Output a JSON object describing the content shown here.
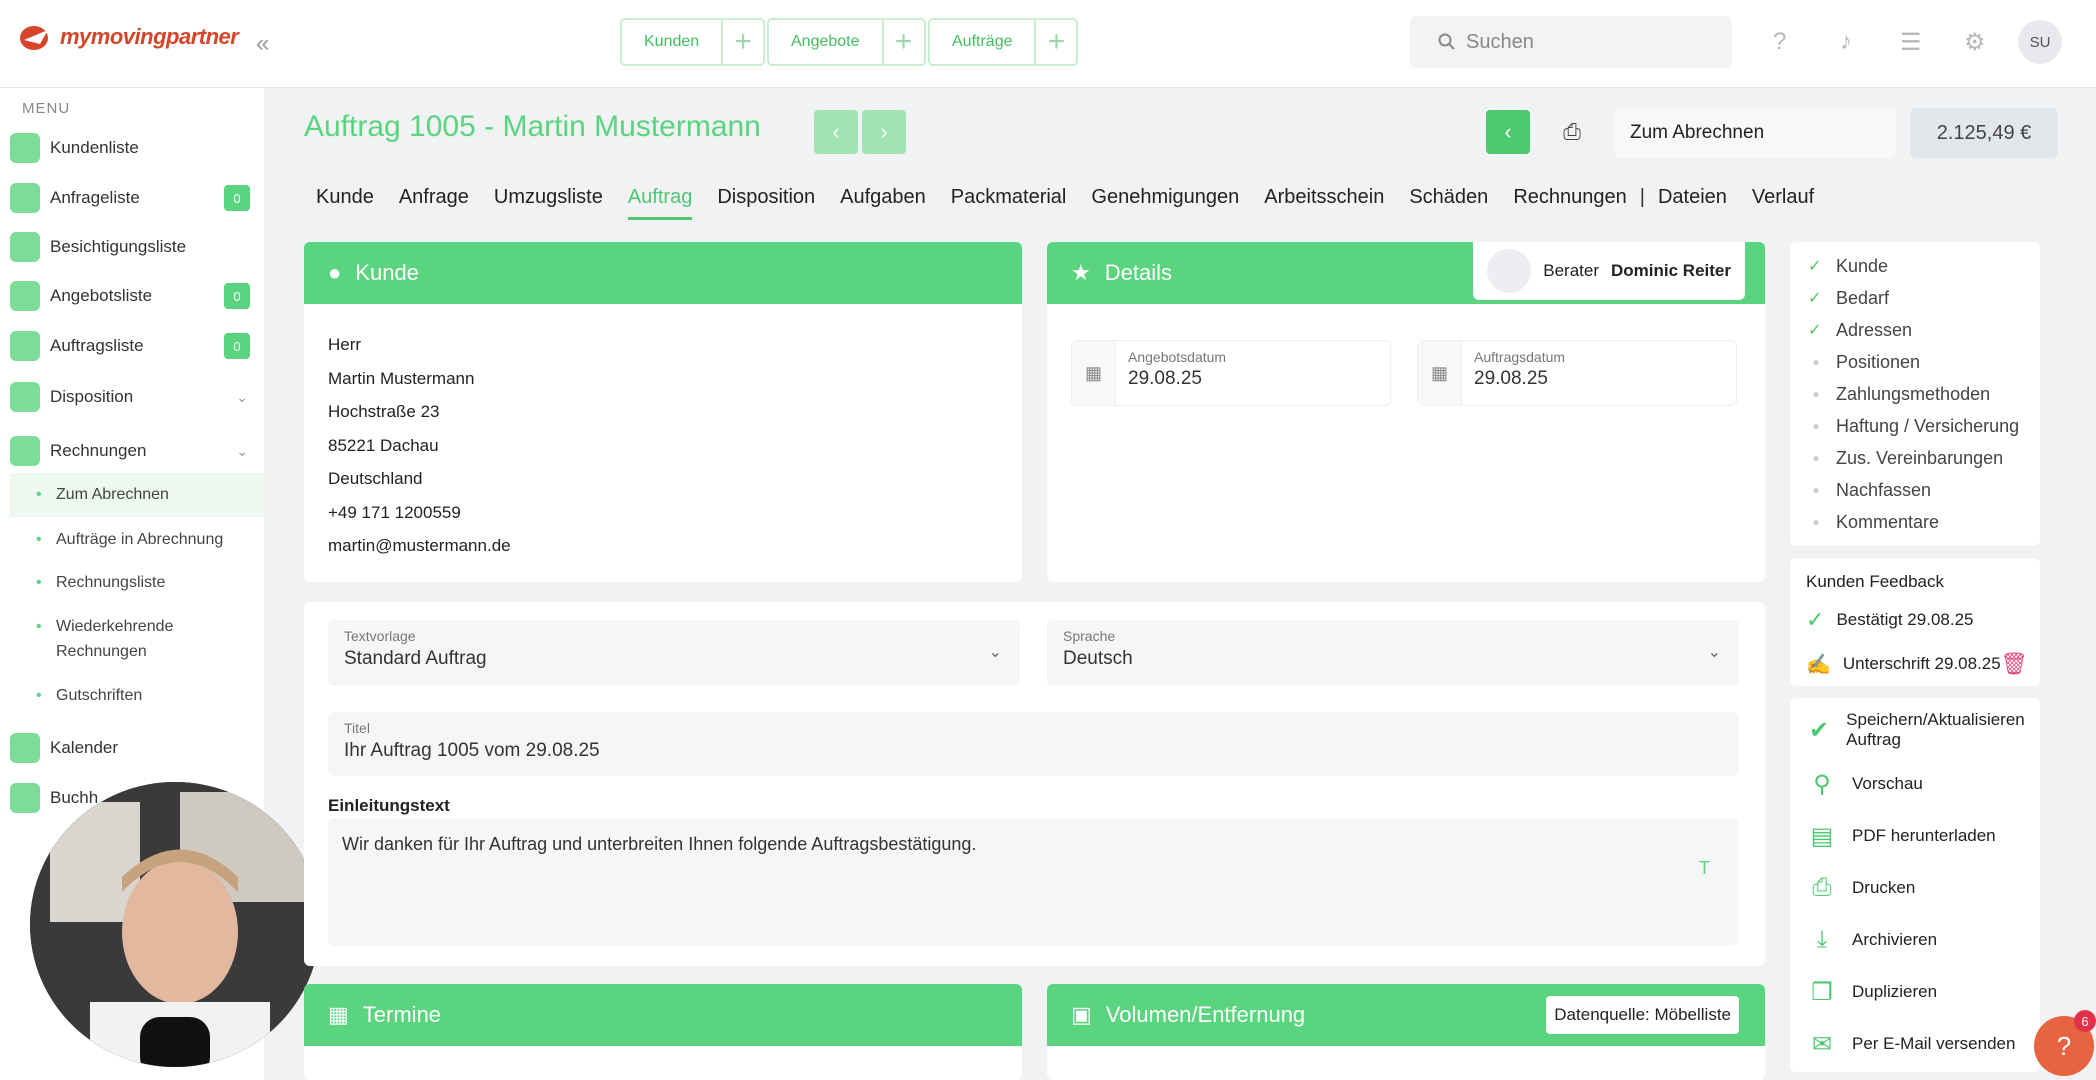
{
  "app": {
    "logo_text": "mymovingpartner",
    "collapse_icon": "«",
    "avatar": "SU"
  },
  "quick": [
    {
      "label": "Kunden"
    },
    {
      "label": "Angebote"
    },
    {
      "label": "Aufträge"
    }
  ],
  "search": {
    "placeholder": "Suchen"
  },
  "sidebar": {
    "menu_heading": "MENU",
    "items": [
      {
        "label": "Kundenliste",
        "badge": ""
      },
      {
        "label": "Anfrageliste",
        "badge": "0"
      },
      {
        "label": "Besichtigungsliste",
        "badge": ""
      },
      {
        "label": "Angebotsliste",
        "badge": "0"
      },
      {
        "label": "Auftragsliste",
        "badge": "0"
      },
      {
        "label": "Disposition",
        "badge": ""
      },
      {
        "label": "Rechnungen",
        "badge": ""
      }
    ],
    "sub_items": [
      "Zum Abrechnen",
      "Aufträge in Abrechnung",
      "Rechnungsliste",
      "Wiederkehrende Rechnungen",
      "Gutschriften"
    ],
    "after_items": [
      "Kalender",
      "Buchh"
    ]
  },
  "header": {
    "title": "Auftrag 1005 - Martin Mustermann",
    "status": "Zum Abrechnen",
    "total": "2.125,49 €"
  },
  "tabs": [
    "Kunde",
    "Anfrage",
    "Umzugsliste",
    "Auftrag",
    "Disposition",
    "Aufgaben",
    "Packmaterial",
    "Genehmigungen",
    "Arbeitsschein",
    "Schäden",
    "Rechnungen",
    "|",
    "Dateien",
    "Verlauf"
  ],
  "kunde": {
    "heading": "Kunde",
    "lines": [
      "Herr",
      "Martin Mustermann",
      "Hochstraße 23",
      "85221 Dachau",
      "Deutschland",
      "+49 171 1200559",
      "martin@mustermann.de"
    ]
  },
  "details": {
    "heading": "Details",
    "berater_label": "Berater",
    "berater_name": "Dominic Reiter",
    "angebotsdatum_label": "Angebotsdatum",
    "angebotsdatum": "29.08.25",
    "auftragsdatum_label": "Auftragsdatum",
    "auftragsdatum": "29.08.25"
  },
  "form": {
    "textvorlage_label": "Textvorlage",
    "textvorlage": "Standard Auftrag",
    "sprache_label": "Sprache",
    "sprache": "Deutsch",
    "titel_label": "Titel",
    "titel": "Ihr Auftrag 1005 vom 29.08.25",
    "einleitung_label": "Einleitungstext",
    "einleitung": "Wir danken für Ihr Auftrag und unterbreiten Ihnen folgende Auftragsbestätigung."
  },
  "bottom": {
    "termine": "Termine",
    "volumen": "Volumen/Entfernung",
    "datenquelle": "Datenquelle: Möbelliste"
  },
  "checklist": [
    {
      "label": "Kunde",
      "done": true
    },
    {
      "label": "Bedarf",
      "done": true
    },
    {
      "label": "Adressen",
      "done": true
    },
    {
      "label": "Positionen",
      "done": false
    },
    {
      "label": "Zahlungsmethoden",
      "done": false
    },
    {
      "label": "Haftung / Versicherung",
      "done": false
    },
    {
      "label": "Zus. Vereinbarungen",
      "done": false
    },
    {
      "label": "Nachfassen",
      "done": false
    },
    {
      "label": "Kommentare",
      "done": false
    }
  ],
  "feedback": {
    "heading": "Kunden Feedback",
    "confirmed": "Bestätigt 29.08.25",
    "signature": "Unterschrift 29.08.25"
  },
  "actions": [
    "Speichern/Aktualisieren Auftrag",
    "Vorschau",
    "PDF herunterladen",
    "Drucken",
    "Archivieren",
    "Duplizieren",
    "Per E-Mail versenden"
  ],
  "help": {
    "label": "?",
    "count": "6"
  },
  "colors": {
    "accent": "#5ad47e",
    "accent_dark": "#4cc86f",
    "logo": "#d6452a"
  }
}
